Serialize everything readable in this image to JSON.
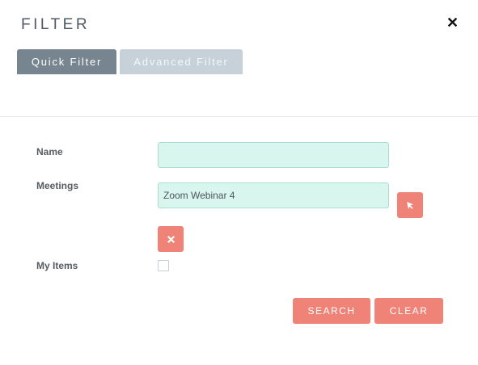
{
  "dialog": {
    "title": "FILTER",
    "close_icon": "close-icon"
  },
  "tabs": [
    {
      "label": "Quick Filter",
      "active": true
    },
    {
      "label": "Advanced Filter",
      "active": false
    }
  ],
  "form": {
    "name": {
      "label": "Name",
      "value": "",
      "placeholder": ""
    },
    "meetings": {
      "label": "Meetings",
      "value": "Zoom Webinar 4",
      "select_icon": "cursor-arrow-icon",
      "clear_icon": "close-icon"
    },
    "my_items": {
      "label": "My Items",
      "checked": false
    }
  },
  "actions": {
    "search_label": "SEARCH",
    "clear_label": "CLEAR"
  },
  "colors": {
    "accent": "#f08377",
    "input_bg": "#d8f5ee",
    "tab_active": "#778591",
    "tab_inactive": "#c6d1da"
  }
}
